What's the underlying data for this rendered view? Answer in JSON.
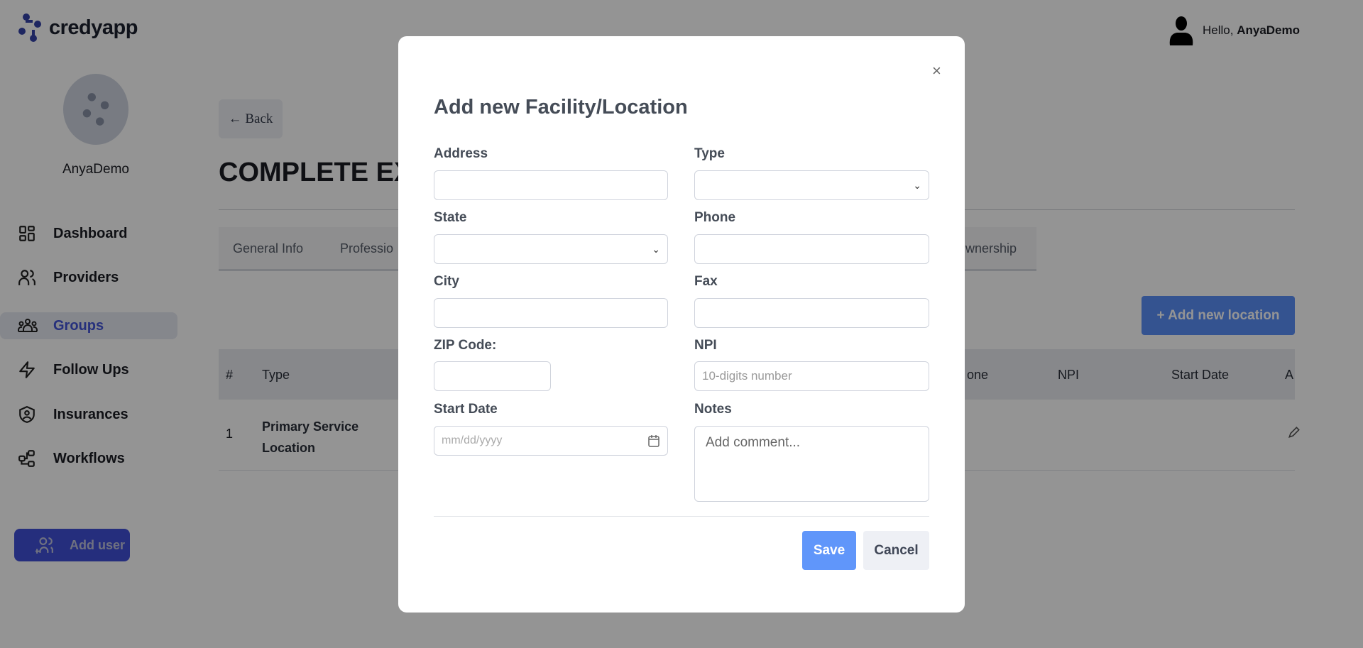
{
  "app": {
    "logo_text": "credyapp",
    "greeting": "Hello,",
    "user": "AnyaDemo",
    "brand_color": "#3443a8"
  },
  "sidebar": {
    "username": "AnyaDemo",
    "items": [
      {
        "label": "Dashboard",
        "icon": "grid-icon"
      },
      {
        "label": "Providers",
        "icon": "users-icon"
      },
      {
        "label": "Groups",
        "icon": "group-icon",
        "active": true
      },
      {
        "label": "Follow Ups",
        "icon": "lightning-icon"
      },
      {
        "label": "Insurances",
        "icon": "shield-icon"
      },
      {
        "label": "Workflows",
        "icon": "workflow-icon"
      }
    ],
    "add_user": "Add user"
  },
  "page": {
    "back": "Back",
    "title": "COMPLETE EX",
    "tabs": [
      "General Info",
      "Professio",
      "wnership"
    ],
    "add_location": "+ Add new location",
    "table": {
      "headers": [
        "#",
        "Type",
        "one",
        "NPI",
        "Start Date",
        "A"
      ],
      "rows": [
        {
          "num": "1",
          "type_line1": "Primary Service",
          "type_line2": "Location"
        }
      ]
    }
  },
  "modal": {
    "title": "Add new Facility/Location",
    "fields": {
      "address": "Address",
      "type": "Type",
      "state": "State",
      "phone": "Phone",
      "city": "City",
      "fax": "Fax",
      "zip": "ZIP Code:",
      "npi": "NPI",
      "npi_placeholder": "10-digits number",
      "start_date": "Start Date",
      "start_date_placeholder": "mm/dd/yyyy",
      "notes": "Notes",
      "notes_placeholder": "Add comment..."
    },
    "save": "Save",
    "cancel": "Cancel"
  }
}
